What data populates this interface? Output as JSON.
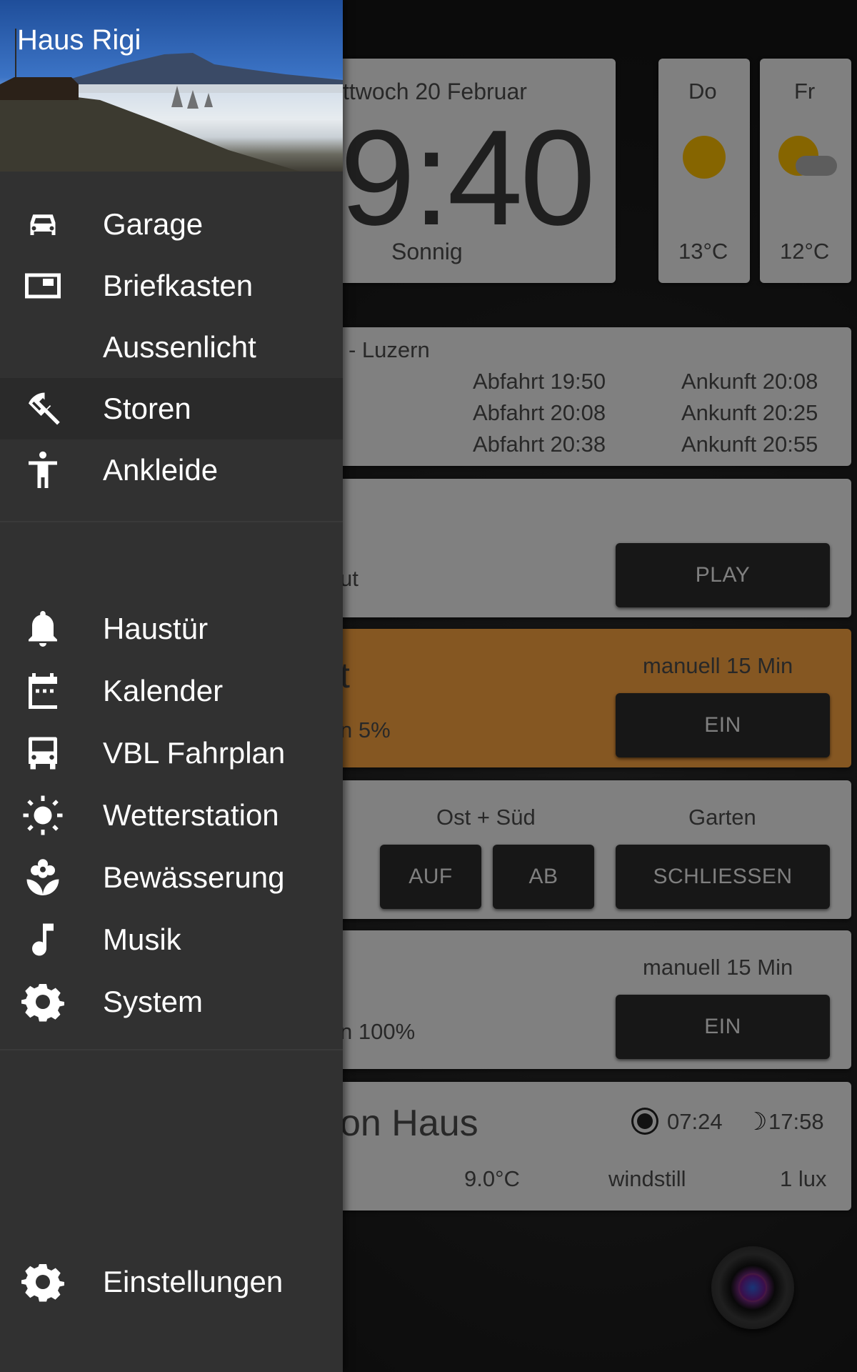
{
  "drawer": {
    "title": "Haus Rigi",
    "group1": [
      {
        "label": "Garage",
        "icon": "car-icon"
      },
      {
        "label": "Briefkasten",
        "icon": "mailbox-icon"
      },
      {
        "label": "Aussenlicht",
        "icon": "moon-icon"
      },
      {
        "label": "Storen",
        "icon": "umbrella-icon",
        "active": true
      },
      {
        "label": "Ankleide",
        "icon": "person-icon"
      }
    ],
    "group2": [
      {
        "label": "Haustür",
        "icon": "bell-icon"
      },
      {
        "label": "Kalender",
        "icon": "calendar-icon"
      },
      {
        "label": "VBL Fahrplan",
        "icon": "bus-icon"
      },
      {
        "label": "Wetterstation",
        "icon": "sun-icon"
      },
      {
        "label": "Bewässerung",
        "icon": "flower-icon"
      },
      {
        "label": "Musik",
        "icon": "music-note-icon"
      },
      {
        "label": "System",
        "icon": "gear-icon"
      }
    ],
    "settings": {
      "label": "Einstellungen",
      "icon": "gear-icon"
    }
  },
  "clock": {
    "date": "ttwoch 20 Februar",
    "time": "9:40",
    "condition": "Sonnig"
  },
  "forecast": [
    {
      "day": "Do",
      "temp": "13°C",
      "icon": "sun-icon"
    },
    {
      "day": "Fr",
      "temp": "12°C",
      "icon": "partly-cloudy-icon"
    }
  ],
  "timetable": {
    "route": "- Luzern",
    "rows": [
      {
        "dep": "Abfahrt 19:50",
        "arr": "Ankunft 20:08"
      },
      {
        "dep": "Abfahrt 20:08",
        "arr": "Ankunft 20:25"
      },
      {
        "dep": "Abfahrt 20:38",
        "arr": "Ankunft 20:55"
      }
    ]
  },
  "music": {
    "partial": "ut",
    "play_label": "PLAY"
  },
  "light1": {
    "partial_title": "t",
    "mode": "manuell 15 Min",
    "status": "n 5%",
    "button": "EIN"
  },
  "blinds": {
    "group1": "Ost + Süd",
    "up": "AUF",
    "down": "AB",
    "group2": "Garten",
    "close": "SCHLIESSEN"
  },
  "light2": {
    "mode": "manuell 15 Min",
    "status": "n 100%",
    "button": "EIN"
  },
  "weather_station": {
    "title": "on Haus",
    "sunrise": "07:24",
    "sunset": "17:58",
    "temp": "9.0°C",
    "wind": "windstill",
    "light": "1 lux"
  },
  "colors": {
    "accent_orange": "#f29e3f",
    "drawer_bg": "#313131",
    "card_bg": "#e9e9e9"
  }
}
